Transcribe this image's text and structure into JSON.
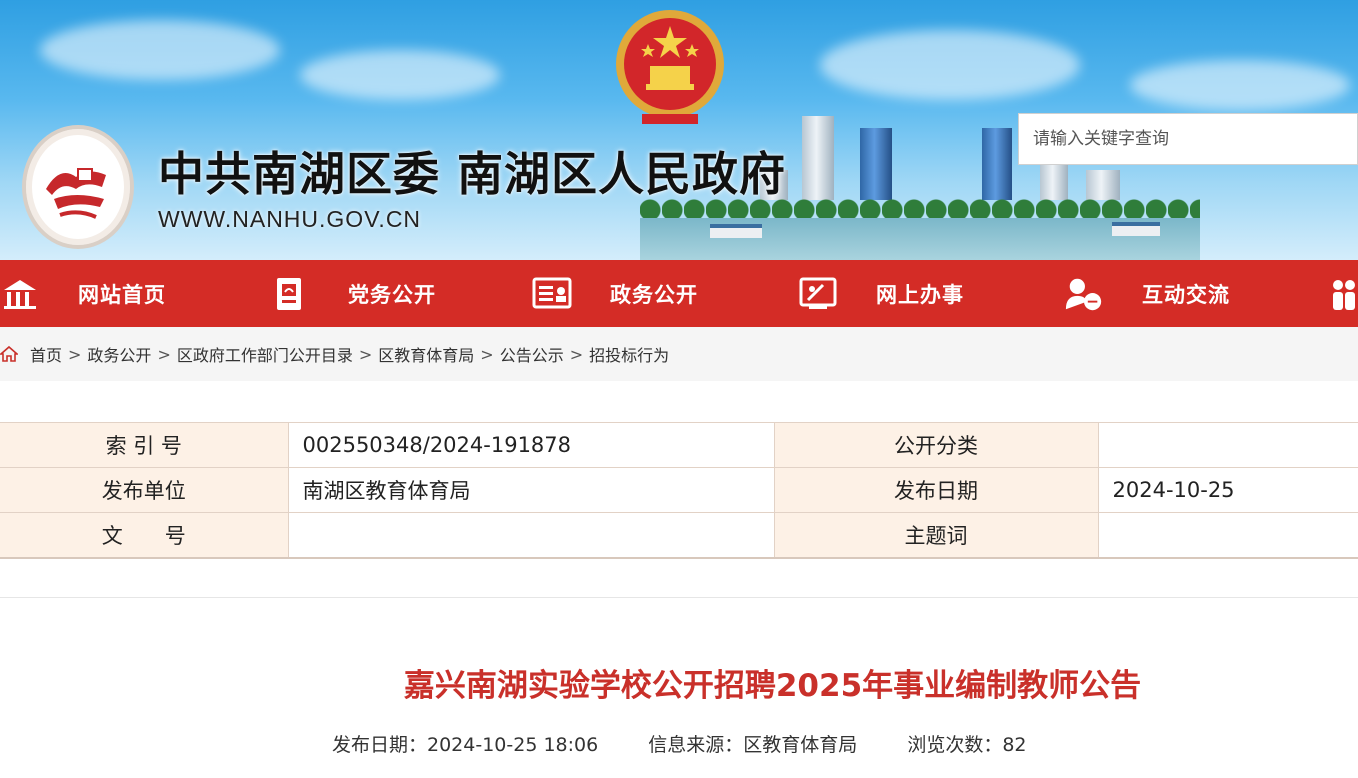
{
  "header": {
    "title": "中共南湖区委 南湖区人民政府",
    "url": "WWW.NANHU.GOV.CN",
    "search": {
      "placeholder": "请输入关键字查询",
      "value": ""
    }
  },
  "nav": {
    "items": [
      {
        "label": "网站首页",
        "icon": "home-icon"
      },
      {
        "label": "党务公开",
        "icon": "party-icon"
      },
      {
        "label": "政务公开",
        "icon": "document-icon"
      },
      {
        "label": "网上办事",
        "icon": "service-icon"
      },
      {
        "label": "互动交流",
        "icon": "chat-user-icon"
      },
      {
        "label": "",
        "icon": "people-icon"
      }
    ]
  },
  "breadcrumb": {
    "items": [
      "首页",
      "政务公开",
      "区政府工作部门公开目录",
      "区教育体育局",
      "公告公示",
      "招投标行为"
    ],
    "separator": ">"
  },
  "meta": {
    "rows": [
      {
        "k1": "索 引 号",
        "v1": "002550348/2024-191878",
        "k2": "公开分类",
        "v2": ""
      },
      {
        "k1": "发布单位",
        "v1": "南湖区教育体育局",
        "k2": "发布日期",
        "v2": "2024-10-25"
      },
      {
        "k1": "文　　号",
        "v1": "",
        "k2": "主题词",
        "v2": ""
      }
    ]
  },
  "article": {
    "title": "嘉兴南湖实验学校公开招聘2025年事业编制教师公告",
    "date": "发布日期：2024-10-25 18:06",
    "source": "信息来源：区教育体育局",
    "views": "浏览次数：82"
  },
  "colors": {
    "nav_bg": "#d42c26",
    "title_red": "#c9302a",
    "table_key_bg": "#fdf1e6"
  }
}
